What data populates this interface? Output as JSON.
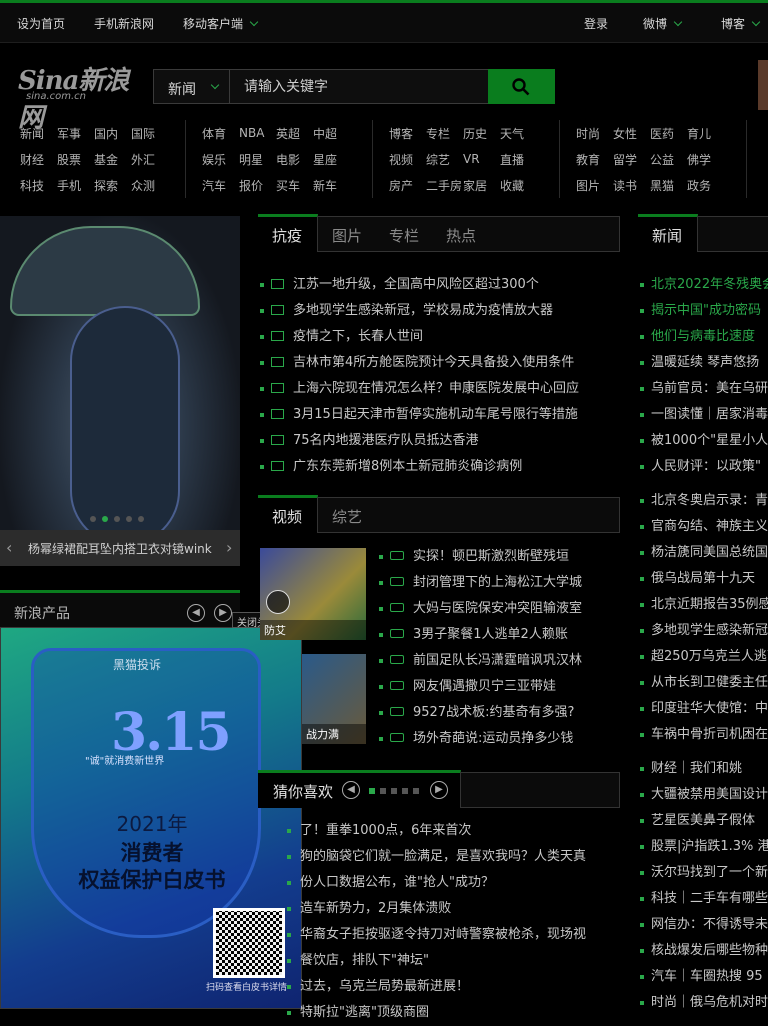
{
  "topbar": {
    "set_home": "设为首页",
    "mobile_sina": "手机新浪网",
    "mobile_client": "移动客户端",
    "login": "登录",
    "weibo": "微博",
    "blog": "博客"
  },
  "logo": {
    "main": "Sina新浪网",
    "domain": "sina.com.cn"
  },
  "search": {
    "category": "新闻",
    "placeholder": "请输入关键字"
  },
  "nav": {
    "group1": [
      [
        "新闻",
        "军事",
        "国内",
        "国际"
      ],
      [
        "财经",
        "股票",
        "基金",
        "外汇"
      ],
      [
        "科技",
        "手机",
        "探索",
        "众测"
      ]
    ],
    "group2": [
      [
        "体育",
        "NBA",
        "英超",
        "中超"
      ],
      [
        "娱乐",
        "明星",
        "电影",
        "星座"
      ],
      [
        "汽车",
        "报价",
        "买车",
        "新车"
      ]
    ],
    "group3": [
      [
        "博客",
        "专栏",
        "历史",
        "天气"
      ],
      [
        "视频",
        "综艺",
        "VR",
        "直播"
      ],
      [
        "房产",
        "二手房",
        "家居",
        "收藏"
      ]
    ],
    "group4": [
      [
        "时尚",
        "女性",
        "医药",
        "育儿"
      ],
      [
        "教育",
        "留学",
        "公益",
        "佛学"
      ],
      [
        "图片",
        "读书",
        "黑猫",
        "政务"
      ]
    ]
  },
  "slideshow": {
    "caption": "杨幂绿裙配耳坠内搭卫衣对镜wink"
  },
  "new_products": {
    "title": "新浪产品"
  },
  "ad": {
    "close": "关闭头条版",
    "brand": "黑猫投诉",
    "big": "3.15",
    "sub": "\"诚\"就消费新世界",
    "line1": "2021年",
    "line2": "消费者",
    "line3": "权益保护白皮书",
    "qr_caption": "扫码查看白皮书详情"
  },
  "tabs_main": [
    "抗疫",
    "图片",
    "专栏",
    "热点"
  ],
  "news_main": [
    "江苏一地升级，全国高中风险区超过300个",
    "多地现学生感染新冠，学校易成为疫情放大器",
    "疫情之下，长春人世间",
    "吉林市第4所方舱医院预计今天具备投入使用条件",
    "上海六院现在情况怎么样？申康医院发展中心回应",
    "3月15日起天津市暂停实施机动车尾号限行等措施",
    "75名内地援港医疗队员抵达香港",
    "广东东莞新增8例本土新冠肺炎确诊病例"
  ],
  "tabs_video": [
    "视频",
    "综艺"
  ],
  "video_thumbs": [
    "防艾"
  ],
  "video_thumb2": "战力满",
  "news_video": [
    "实探！顿巴斯激烈断壁残垣",
    "封闭管理下的上海松江大学城",
    "大妈与医院保安冲突阻输液室",
    "3男子聚餐1人逃单2人赖账",
    "前国足队长冯潇霆暗讽巩汉林",
    "网友偶遇撒贝宁三亚带娃",
    "9527战术板:约基奇有多强?",
    "场外奇葩说:运动员挣多少钱"
  ],
  "guess": {
    "title": "猜你喜欢"
  },
  "news_guess": [
    "了！重拳1000点，6年来首次",
    "狗的脑袋它们就一脸满足，是喜欢我吗？人类天真",
    "份人口数据公布，谁\"抢人\"成功？",
    "造车新势力，2月集体溃败",
    "华裔女子拒按驱逐令持刀对峙警察被枪杀，现场视",
    "餐饮店，排队下\"神坛\"",
    "过去，乌克兰局势最新进展！",
    "特斯拉\"逃离\"顶级商圈"
  ],
  "right_tabs": [
    "新闻"
  ],
  "news_right": [
    "北京2022年冬残奥会",
    "揭示中国\"成功密码",
    "他们与病毒比速度",
    "温暖延续 琴声悠扬",
    "乌前官员：美在乌研",
    "一图读懂｜居家消毒",
    "被1000个\"星星小人\"",
    "人民财评：以政策\"",
    "北京冬奥启示录：青",
    "官商勾结、神族主义",
    "杨洁篪同美国总统国",
    "俄乌战局第十九天",
    "北京近期报告35例感",
    "多地现学生感染新冠",
    "超250万乌克兰人逃离",
    "从市长到卫健委主任",
    "印度驻华大使馆：中",
    "车祸中骨折司机困在",
    "财经｜我们和姚",
    "大疆被禁用美国设计",
    "艺星医美鼻子假体",
    "股票|沪指跌1.3% 港",
    "沃尔玛找到了一个新",
    "科技｜二手车有哪些",
    "网信办：不得诱导未",
    "核战爆发后哪些物种",
    "汽车｜车圈热搜 95",
    "时尚｜俄乌危机对时"
  ]
}
